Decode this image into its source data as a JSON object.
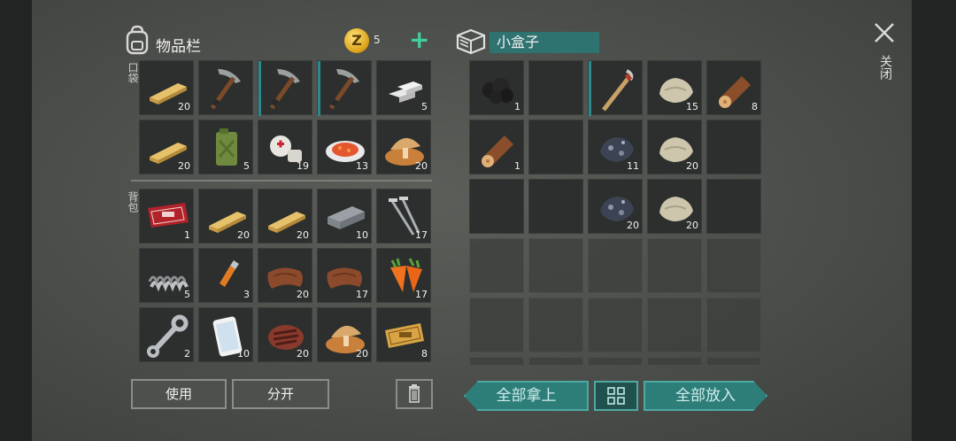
{
  "inventory": {
    "title": "物品栏",
    "coins": "5",
    "pockets_label": "口袋",
    "backpack_label": "背包",
    "pockets": [
      {
        "item": "wood-plank",
        "qty": "20"
      },
      {
        "item": "pickaxe",
        "qty": ""
      },
      {
        "item": "pickaxe",
        "qty": ""
      },
      {
        "item": "pickaxe",
        "qty": ""
      },
      {
        "item": "iron-ingots",
        "qty": "5"
      },
      {
        "item": "wood-plank",
        "qty": "20"
      },
      {
        "item": "jerrycan",
        "qty": "5"
      },
      {
        "item": "bandage",
        "qty": "19"
      },
      {
        "item": "food-plate",
        "qty": "13"
      },
      {
        "item": "mushroom-meal",
        "qty": "20"
      }
    ],
    "backpack": [
      {
        "item": "coupon-red",
        "qty": "1"
      },
      {
        "item": "wood-plank",
        "qty": "20"
      },
      {
        "item": "wood-plank",
        "qty": "20"
      },
      {
        "item": "iron-bar",
        "qty": "10"
      },
      {
        "item": "nails",
        "qty": "17"
      },
      {
        "item": "spring",
        "qty": "5"
      },
      {
        "item": "lighter",
        "qty": "3"
      },
      {
        "item": "leather",
        "qty": "20"
      },
      {
        "item": "leather",
        "qty": "17"
      },
      {
        "item": "carrots",
        "qty": "17"
      },
      {
        "item": "wrench",
        "qty": "2"
      },
      {
        "item": "smartphone",
        "qty": "10"
      },
      {
        "item": "steak",
        "qty": "20"
      },
      {
        "item": "mushroom-meal",
        "qty": "20"
      },
      {
        "item": "coupon-gold",
        "qty": "8"
      }
    ],
    "use_button": "使用",
    "split_button": "分开"
  },
  "container": {
    "title": "小盒子",
    "slots": [
      {
        "item": "coal",
        "qty": "1"
      },
      {
        "item": "",
        "qty": ""
      },
      {
        "item": "crowbar",
        "qty": ""
      },
      {
        "item": "stone",
        "qty": "15"
      },
      {
        "item": "log",
        "qty": "8"
      },
      {
        "item": "log",
        "qty": "1"
      },
      {
        "item": "",
        "qty": ""
      },
      {
        "item": "iron-ore",
        "qty": "11"
      },
      {
        "item": "stone",
        "qty": "20"
      },
      {
        "item": "",
        "qty": ""
      },
      {
        "item": "",
        "qty": ""
      },
      {
        "item": "",
        "qty": ""
      },
      {
        "item": "iron-ore",
        "qty": "20"
      },
      {
        "item": "stone",
        "qty": "20"
      },
      {
        "item": "",
        "qty": ""
      }
    ],
    "take_all_button": "全部拿上",
    "put_all_button": "全部放入"
  },
  "close_label": "关闭"
}
